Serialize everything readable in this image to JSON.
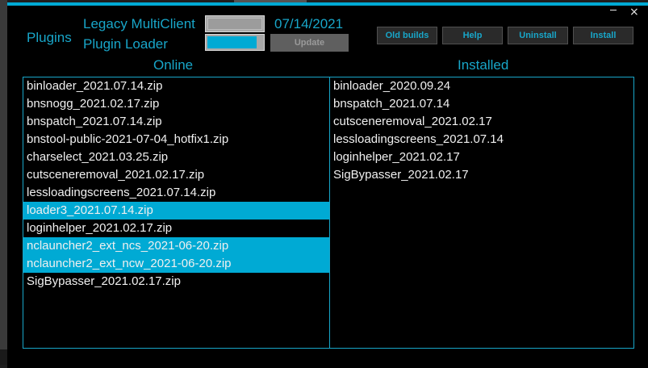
{
  "window": {
    "minimize_glyph": "_",
    "close_glyph": "×"
  },
  "header": {
    "plugins_label": "Plugins",
    "app_title_line1": "Legacy MultiClient",
    "app_title_line2": "Plugin Loader",
    "date": "07/14/2021",
    "update_label": "Update",
    "progress_bottom_fraction": 0.9
  },
  "buttons": {
    "old_builds": "Old builds",
    "help": "Help",
    "uninstall": "Uninstall",
    "install": "Install"
  },
  "online": {
    "header": "Online",
    "items": [
      {
        "label": "binloader_2021.07.14.zip",
        "selected": false
      },
      {
        "label": "bnsnogg_2021.02.17.zip",
        "selected": false
      },
      {
        "label": "bnspatch_2021.07.14.zip",
        "selected": false
      },
      {
        "label": "bnstool-public-2021-07-04_hotfix1.zip",
        "selected": false
      },
      {
        "label": "charselect_2021.03.25.zip",
        "selected": false
      },
      {
        "label": "cutsceneremoval_2021.02.17.zip",
        "selected": false
      },
      {
        "label": "lessloadingscreens_2021.07.14.zip",
        "selected": false
      },
      {
        "label": "loader3_2021.07.14.zip",
        "selected": true
      },
      {
        "label": "loginhelper_2021.02.17.zip",
        "selected": false
      },
      {
        "label": "nclauncher2_ext_ncs_2021-06-20.zip",
        "selected": true
      },
      {
        "label": "nclauncher2_ext_ncw_2021-06-20.zip",
        "selected": true
      },
      {
        "label": "SigBypasser_2021.02.17.zip",
        "selected": false
      }
    ]
  },
  "installed": {
    "header": "Installed",
    "items": [
      {
        "label": "binloader_2020.09.24"
      },
      {
        "label": "bnspatch_2021.07.14"
      },
      {
        "label": "cutsceneremoval_2021.02.17"
      },
      {
        "label": "lessloadingscreens_2021.07.14"
      },
      {
        "label": "loginhelper_2021.02.17"
      },
      {
        "label": "SigBypasser_2021.02.17"
      }
    ]
  },
  "colors": {
    "accent": "#00aad4",
    "text": "#18a6c9",
    "background": "#000000"
  }
}
